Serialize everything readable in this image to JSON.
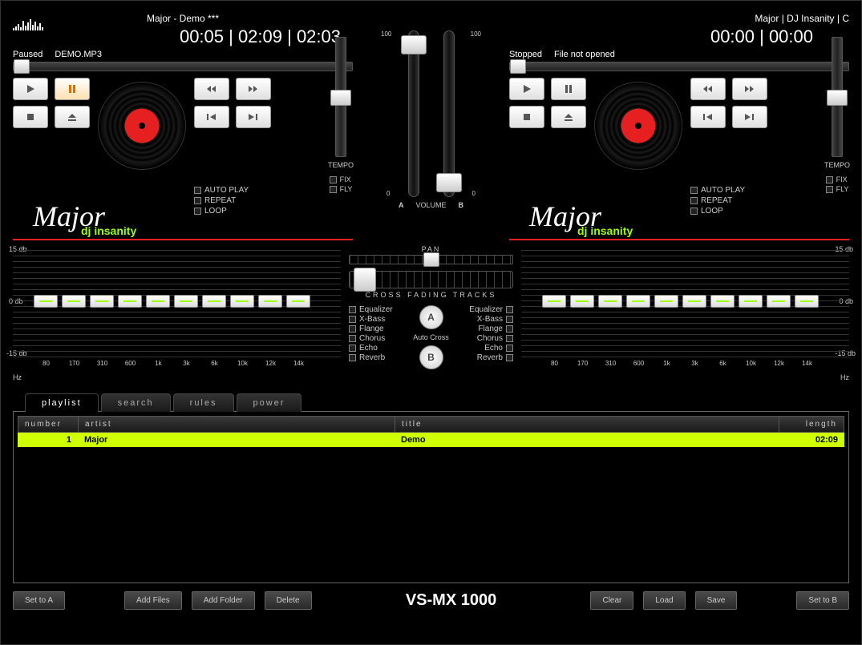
{
  "deckA": {
    "title": "Major - Demo ***",
    "time": "00:05 | 02:09 | 02:03",
    "status": "Paused",
    "file": "DEMO.MP3",
    "options": {
      "autoplay": "AUTO PLAY",
      "repeat": "REPEAT",
      "loop": "LOOP"
    },
    "tempo": {
      "label": "TEMPO",
      "fix": "FIX",
      "fly": "FLY"
    },
    "logo": "Major",
    "logo_sub": "dj insanity"
  },
  "deckB": {
    "title": "Major | DJ Insanity | C",
    "time": "00:00 | 00:00",
    "status": "Stopped",
    "file": "File not opened",
    "options": {
      "autoplay": "AUTO PLAY",
      "repeat": "REPEAT",
      "loop": "LOOP"
    },
    "tempo": {
      "label": "TEMPO",
      "fix": "FIX",
      "fly": "FLY"
    },
    "logo": "Major",
    "logo_sub": "dj insanity"
  },
  "center": {
    "scale_top": "100",
    "scale_bot": "0",
    "vol_a": "A",
    "volume": "VOLUME",
    "vol_b": "B",
    "pan": "PAN",
    "cross": "CROSS FADING TRACKS",
    "fx": {
      "eq": "Equalizer",
      "xbass": "X-Bass",
      "flange": "Flange",
      "chorus": "Chorus",
      "echo": "Echo",
      "reverb": "Reverb"
    },
    "btn_a": "A",
    "btn_b": "B",
    "autocross": "Auto Cross"
  },
  "eq": {
    "db15": "15 db",
    "db0": "0 db",
    "dbm15": "-15 db",
    "hz": "Hz",
    "bands": [
      "80",
      "170",
      "310",
      "600",
      "1k",
      "3k",
      "6k",
      "10k",
      "12k",
      "14k"
    ]
  },
  "tabs": {
    "playlist": "playlist",
    "search": "search",
    "rules": "rules",
    "power": "power"
  },
  "playlist": {
    "headers": {
      "num": "number",
      "artist": "artist",
      "title": "title",
      "len": "length"
    },
    "rows": [
      {
        "num": "1",
        "artist": "Major",
        "title": "Demo",
        "len": "02:09"
      }
    ]
  },
  "footer": {
    "setA": "Set to A",
    "addFiles": "Add Files",
    "addFolder": "Add Folder",
    "delete": "Delete",
    "model": "VS-MX 1000",
    "clear": "Clear",
    "load": "Load",
    "save": "Save",
    "setB": "Set to B"
  }
}
